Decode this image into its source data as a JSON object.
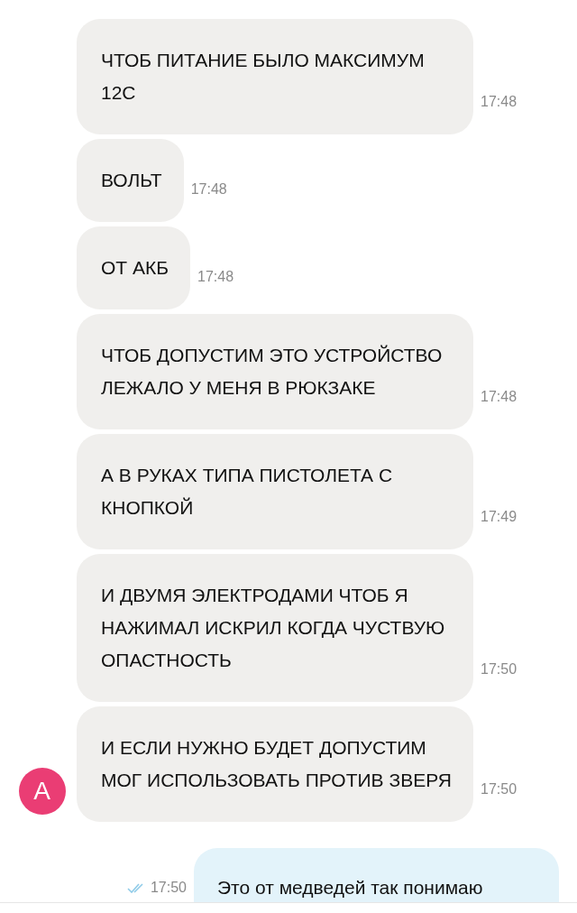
{
  "messages": [
    {
      "kind": "incoming",
      "text": "ЧТОБ ПИТАНИЕ БЫЛО МАКСИМУМ 12С",
      "time": "17:48"
    },
    {
      "kind": "incoming",
      "text": "ВОЛЬТ",
      "time": "17:48"
    },
    {
      "kind": "incoming",
      "text": "ОТ АКБ",
      "time": "17:48"
    },
    {
      "kind": "incoming",
      "text": "ЧТОБ ДОПУСТИМ ЭТО УСТРОЙСТВО ЛЕЖАЛО У МЕНЯ В РЮКЗАКЕ",
      "time": "17:48"
    },
    {
      "kind": "incoming",
      "text": "А В РУКАХ ТИПА ПИСТОЛЕТА С КНОПКОЙ",
      "time": "17:49"
    },
    {
      "kind": "incoming",
      "text": "И ДВУМЯ ЭЛЕКТРОДАМИ ЧТОБ Я НАЖИМАЛ ИСКРИЛ КОГДА ЧУСТВУЮ ОПАСТНОСТЬ",
      "time": "17:50"
    },
    {
      "kind": "incoming",
      "text": "И ЕСЛИ НУЖНО БУДЕТ ДОПУСТИМ МОГ ИСПОЛЬЗОВАТЬ ПРОТИВ ЗВЕРЯ",
      "time": "17:50",
      "avatar": "А"
    },
    {
      "kind": "outgoing",
      "text": "Это от медведей так понимаю",
      "time": "17:50",
      "read": true
    }
  ]
}
